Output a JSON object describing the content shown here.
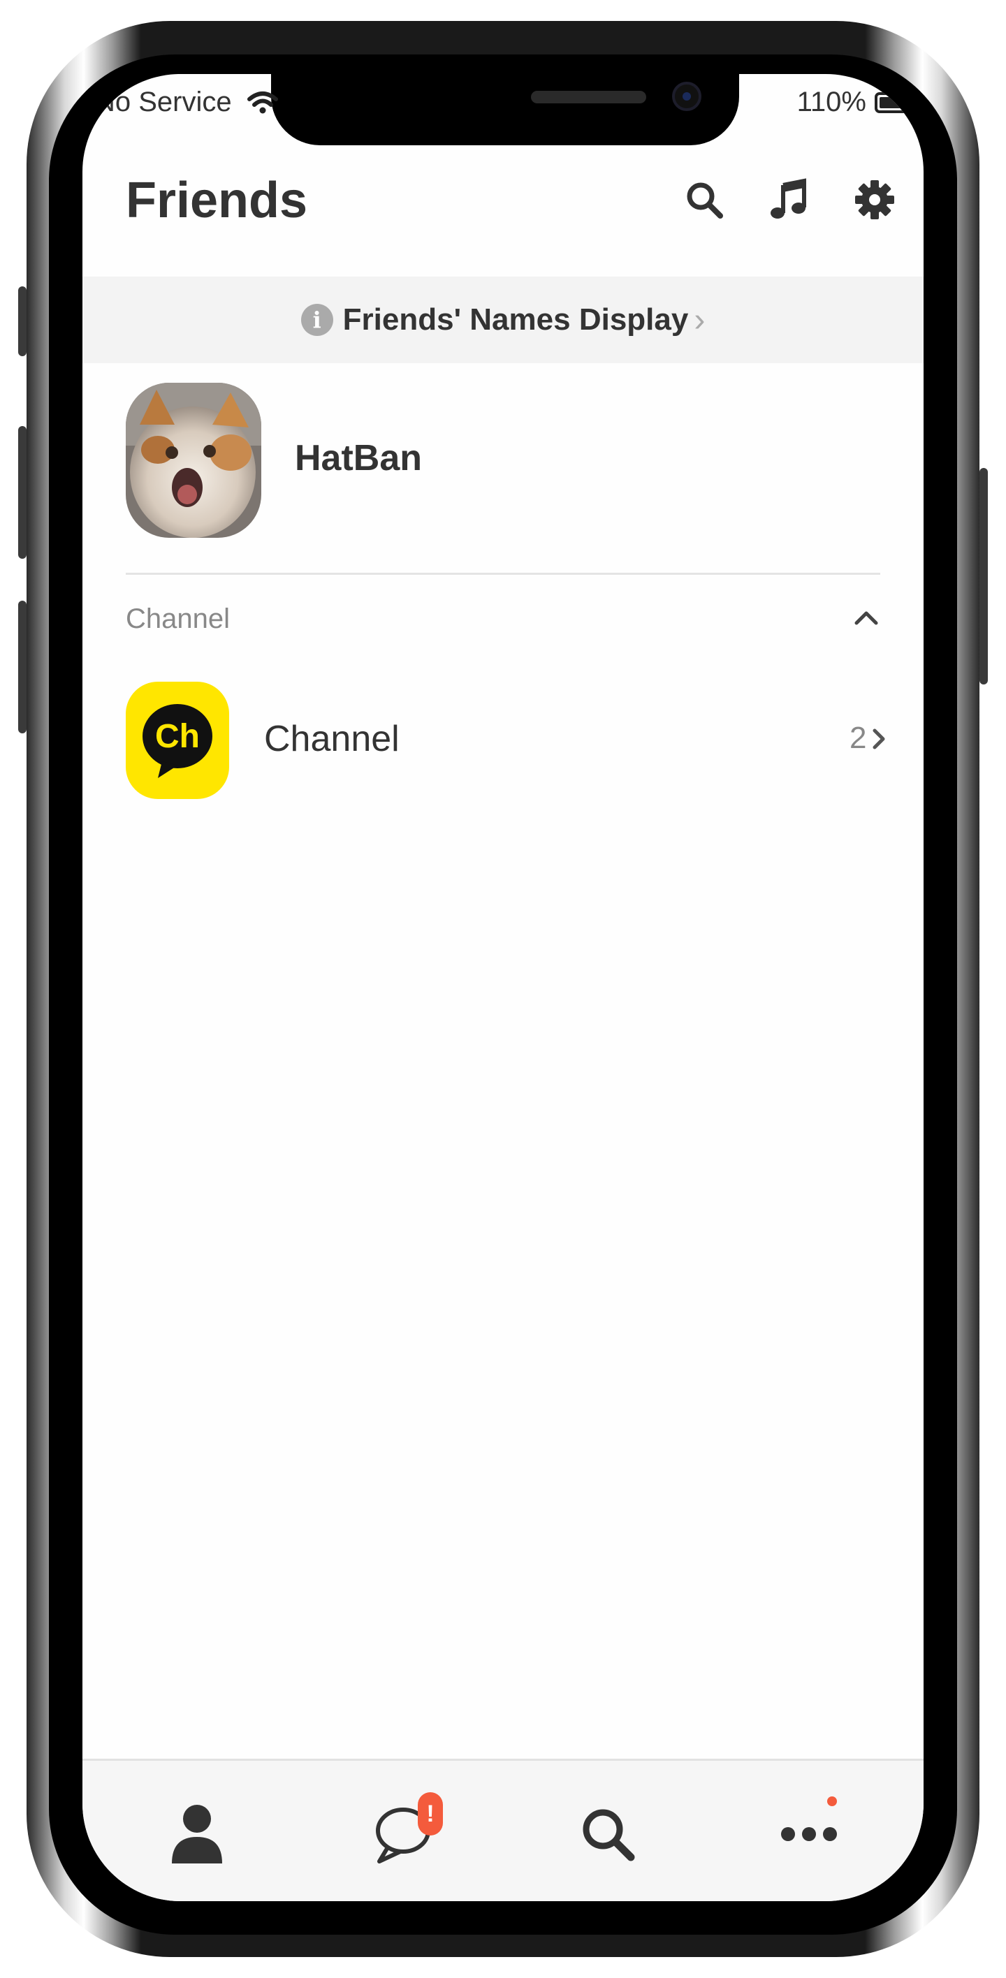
{
  "status_bar": {
    "carrier": "No Service",
    "battery_percent": "110%"
  },
  "header": {
    "title": "Friends",
    "icons": [
      "search-icon",
      "music-icon",
      "gear-icon"
    ]
  },
  "notice": {
    "text": "Friends' Names Display",
    "chevron": "›"
  },
  "profile": {
    "name": "HatBan"
  },
  "channel_section": {
    "label": "Channel",
    "item": {
      "name": "Channel",
      "logo_text": "Ch",
      "count": "2",
      "chevron": "›"
    }
  },
  "tabbar": {
    "tabs": [
      "friends-tab",
      "chats-tab",
      "search-tab",
      "more-tab"
    ],
    "chats_badge": "!"
  },
  "colors": {
    "channel_yellow": "#ffe600",
    "badge_red": "#f45b3c",
    "text_dark": "#333333"
  }
}
